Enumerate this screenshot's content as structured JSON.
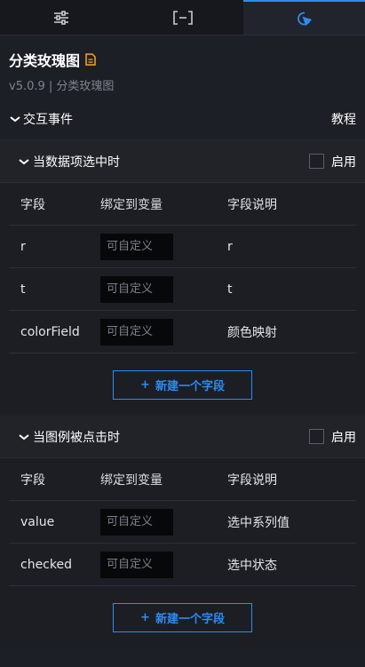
{
  "tabs": [
    {
      "name": "sliders-icon"
    },
    {
      "name": "bracket-icon"
    },
    {
      "name": "interaction-icon",
      "active": true
    }
  ],
  "component": {
    "title": "分类玫瑰图",
    "version": "v5.0.9 | 分类玫瑰图"
  },
  "interaction": {
    "label": "交互事件",
    "tutorial": "教程"
  },
  "events": [
    {
      "title": "当数据项选中时",
      "enable_label": "启用",
      "headers": [
        "字段",
        "绑定到变量",
        "字段说明"
      ],
      "rows": [
        {
          "field": "r",
          "placeholder": "可自定义",
          "desc": "r"
        },
        {
          "field": "t",
          "placeholder": "可自定义",
          "desc": "t"
        },
        {
          "field": "colorField",
          "placeholder": "可自定义",
          "desc": "颜色映射"
        }
      ],
      "add_label": "新建一个字段"
    },
    {
      "title": "当图例被点击时",
      "enable_label": "启用",
      "headers": [
        "字段",
        "绑定到变量",
        "字段说明"
      ],
      "rows": [
        {
          "field": "value",
          "placeholder": "可自定义",
          "desc": "选中系列值"
        },
        {
          "field": "checked",
          "placeholder": "可自定义",
          "desc": "选中状态"
        }
      ],
      "add_label": "新建一个字段"
    }
  ],
  "colors": {
    "accent": "#2d8cf0",
    "doc_icon": "#f5a623",
    "background": "#1d1f26"
  }
}
